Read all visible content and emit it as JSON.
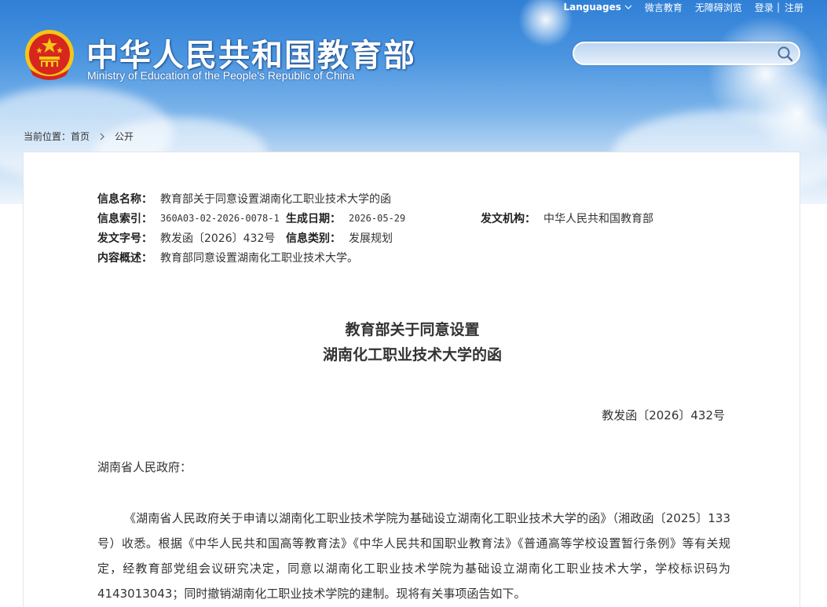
{
  "topbar": {
    "languages": "Languages",
    "weiwei": "微言教育",
    "accessible": "无障碍浏览",
    "login": "登录",
    "separator": "|",
    "register": "注册"
  },
  "header": {
    "title_cn": "中华人民共和国教育部",
    "title_en": "Ministry of Education of the People's Republic of China"
  },
  "search": {
    "placeholder": "",
    "value": ""
  },
  "breadcrumb": {
    "prefix": "当前位置：",
    "home": "首页",
    "current": "公开"
  },
  "meta": {
    "name_label": "信息名称：",
    "name_value": "教育部关于同意设置湖南化工职业技术大学的函",
    "index_label": "信息索引：",
    "index_value": "360A03-02-2026-0078-1",
    "date_label": "生成日期：",
    "date_value": "2026-05-29",
    "issuer_label": "发文机构：",
    "issuer_value": "中华人民共和国教育部",
    "docno_label": "发文字号：",
    "docno_value": "教发函〔2026〕432号",
    "category_label": "信息类别：",
    "category_value": "发展规划",
    "summary_label": "内容概述：",
    "summary_value": "教育部同意设置湖南化工职业技术大学。"
  },
  "document": {
    "title_line1": "教育部关于同意设置",
    "title_line2": "湖南化工职业技术大学的函",
    "number": "教发函〔2026〕432号",
    "addressee": "湖南省人民政府：",
    "paragraph1": "《湖南省人民政府关于申请以湖南化工职业技术学院为基础设立湖南化工职业技术大学的函》（湘政函〔2025〕133号）收悉。根据《中华人民共和国高等教育法》《中华人民共和国职业教育法》《普通高等学校设置暂行条例》等有关规定，经教育部党组会议研究决定，同意以湖南化工职业技术学院为基础设立湖南化工职业技术大学，学校标识码为4143013043；同时撤销湖南化工职业技术学院的建制。现将有关事项函告如下。"
  },
  "colors": {
    "banner_top": "#2f7fd6",
    "text": "#333333",
    "emblem_red": "#d7261e",
    "emblem_gold": "#f5c518"
  }
}
